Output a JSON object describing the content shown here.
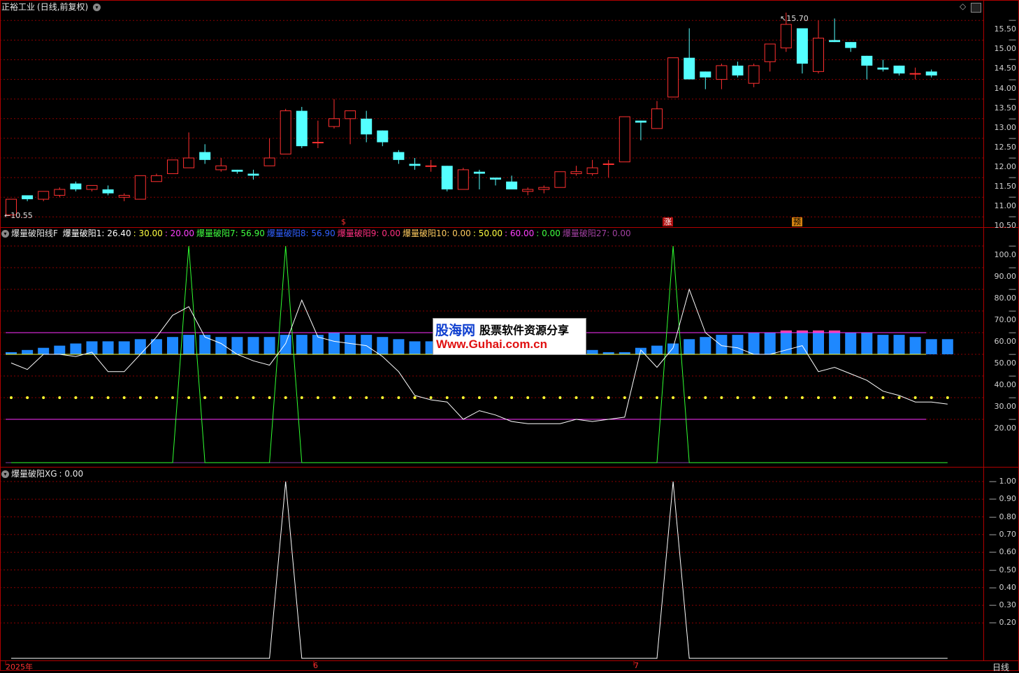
{
  "title": {
    "stock": "正裕工业",
    "period": "(日线,前复权)"
  },
  "price_axis": [
    "15.50",
    "15.00",
    "14.50",
    "14.00",
    "13.50",
    "13.00",
    "12.50",
    "12.00",
    "11.50",
    "11.00",
    "10.50"
  ],
  "price_annotations": {
    "high": "15.70",
    "low": "10.55"
  },
  "event_markers": [
    {
      "label": "$",
      "color": "#ff3030"
    },
    {
      "label": "涨",
      "color": "#ffffff",
      "bg": "#b01010"
    },
    {
      "label": "预",
      "color": "#000000",
      "bg": "#d08010"
    }
  ],
  "panel2": {
    "indicator_name": "爆量破阳线F",
    "legend": [
      {
        "text": "爆量破阳1: 26.40",
        "color": "#ffffff"
      },
      {
        "text": ": 30.00",
        "color": "#ffff40"
      },
      {
        "text": ": 20.00",
        "color": "#ff40ff"
      },
      {
        "text": "爆量破阳7: 56.90",
        "color": "#40ff40"
      },
      {
        "text": "爆量破阳8: 56.90",
        "color": "#3060ff"
      },
      {
        "text": "爆量破阳9: 0.00",
        "color": "#ff3080"
      },
      {
        "text": "爆量破阳10: 0.00",
        "color": "#ffcc60"
      },
      {
        "text": ": 50.00",
        "color": "#ffff40"
      },
      {
        "text": ": 60.00",
        "color": "#ff40ff"
      },
      {
        "text": ": 0.00",
        "color": "#40ff40"
      },
      {
        "text": "爆量破阳27: 0.00",
        "color": "#a040a0"
      }
    ],
    "axis": [
      "100.0",
      "90.00",
      "80.00",
      "70.00",
      "60.00",
      "50.00",
      "40.00",
      "30.00",
      "20.00"
    ]
  },
  "panel3": {
    "indicator_name": "爆量破阳XG",
    "value": ": 0.00",
    "axis": [
      "1.00",
      "0.90",
      "0.80",
      "0.70",
      "0.60",
      "0.50",
      "0.40",
      "0.30",
      "0.20"
    ]
  },
  "bottom_axis": {
    "year": "2025年",
    "m6": "6",
    "m7": "7",
    "period_button": "日线"
  },
  "watermark": {
    "logo": "股海网",
    "slogan": "股票软件资源分享",
    "url": "Www.Guhai.com.cn"
  },
  "colors": {
    "up": "#ff3030",
    "down": "#54ffff",
    "grid": "#8b0000",
    "bar_blue": "#1e88ff",
    "bar_pink": "#ff40a0"
  },
  "chart_data": [
    {
      "type": "candlestick",
      "title": "正裕工业 (日线,前复权)",
      "ylim": [
        10.4,
        15.7
      ],
      "ohlc": [
        [
          10.55,
          10.95,
          10.55,
          10.95
        ],
        [
          11.05,
          11.05,
          10.9,
          10.95
        ],
        [
          10.95,
          11.15,
          10.9,
          11.15
        ],
        [
          11.05,
          11.25,
          11.0,
          11.2
        ],
        [
          11.35,
          11.4,
          11.15,
          11.2
        ],
        [
          11.2,
          11.3,
          11.15,
          11.3
        ],
        [
          11.2,
          11.3,
          11.05,
          11.1
        ],
        [
          11.0,
          11.1,
          10.9,
          11.05
        ],
        [
          10.95,
          11.55,
          10.95,
          11.55
        ],
        [
          11.4,
          11.6,
          11.4,
          11.55
        ],
        [
          11.6,
          11.95,
          11.6,
          11.95
        ],
        [
          11.75,
          12.65,
          11.75,
          12.0
        ],
        [
          12.15,
          12.35,
          11.85,
          11.95
        ],
        [
          11.7,
          12.0,
          11.65,
          11.8
        ],
        [
          11.7,
          11.7,
          11.6,
          11.65
        ],
        [
          11.6,
          11.7,
          11.45,
          11.55
        ],
        [
          11.8,
          12.5,
          11.8,
          12.0
        ],
        [
          12.1,
          13.25,
          12.1,
          13.2
        ],
        [
          13.2,
          13.3,
          12.25,
          12.3
        ],
        [
          12.4,
          12.95,
          12.25,
          12.4
        ],
        [
          12.8,
          13.5,
          12.75,
          13.0
        ],
        [
          13.0,
          13.1,
          12.35,
          13.2
        ],
        [
          13.0,
          13.2,
          12.4,
          12.6
        ],
        [
          12.7,
          12.7,
          12.3,
          12.4
        ],
        [
          12.15,
          12.2,
          11.85,
          11.95
        ],
        [
          11.85,
          12.0,
          11.7,
          11.8
        ],
        [
          11.8,
          11.95,
          11.65,
          11.8
        ],
        [
          11.8,
          11.8,
          11.15,
          11.2
        ],
        [
          11.2,
          11.75,
          11.2,
          11.7
        ],
        [
          11.65,
          11.7,
          11.2,
          11.6
        ],
        [
          11.5,
          11.5,
          11.3,
          11.45
        ],
        [
          11.4,
          11.55,
          11.2,
          11.2
        ],
        [
          11.15,
          11.25,
          11.05,
          11.2
        ],
        [
          11.2,
          11.3,
          11.1,
          11.25
        ],
        [
          11.25,
          11.65,
          11.25,
          11.65
        ],
        [
          11.6,
          11.8,
          11.55,
          11.65
        ],
        [
          11.6,
          11.95,
          11.55,
          11.75
        ],
        [
          11.85,
          11.95,
          11.5,
          11.85
        ],
        [
          11.9,
          13.05,
          11.9,
          13.05
        ],
        [
          12.95,
          12.95,
          12.45,
          12.9
        ],
        [
          12.75,
          13.45,
          12.75,
          13.25
        ],
        [
          13.55,
          14.55,
          13.55,
          14.55
        ],
        [
          14.55,
          15.3,
          14.0,
          14.0
        ],
        [
          14.2,
          14.2,
          13.75,
          14.05
        ],
        [
          14.0,
          14.4,
          13.75,
          14.35
        ],
        [
          14.35,
          14.45,
          14.05,
          14.1
        ],
        [
          13.9,
          14.4,
          13.8,
          14.35
        ],
        [
          14.45,
          14.9,
          14.2,
          14.9
        ],
        [
          14.8,
          15.7,
          14.7,
          15.4
        ],
        [
          15.3,
          15.3,
          14.15,
          14.4
        ],
        [
          14.2,
          15.5,
          14.15,
          15.05
        ],
        [
          15.0,
          15.55,
          14.95,
          14.95
        ],
        [
          14.95,
          14.95,
          14.7,
          14.8
        ],
        [
          14.6,
          14.6,
          14.0,
          14.35
        ],
        [
          14.3,
          14.5,
          14.2,
          14.25
        ],
        [
          14.35,
          14.35,
          14.1,
          14.15
        ],
        [
          14.15,
          14.3,
          14.0,
          14.15
        ],
        [
          14.2,
          14.25,
          14.05,
          14.1
        ]
      ]
    },
    {
      "type": "line",
      "title": "爆量破阳线F",
      "ylim": [
        0,
        100
      ],
      "series": [
        {
          "name": "爆量破阳1",
          "values": [
            46,
            43,
            50,
            50,
            49,
            51,
            42,
            42,
            50,
            58,
            68,
            72,
            58,
            55,
            50,
            47,
            45,
            55,
            75,
            58,
            56,
            55,
            54,
            49,
            42,
            31,
            29,
            28,
            20,
            24,
            22,
            19,
            18,
            18,
            18,
            20,
            19,
            20,
            21,
            52,
            44,
            53,
            80,
            60,
            54,
            53,
            50,
            50,
            52,
            54,
            42,
            44,
            41,
            38,
            33,
            31,
            28,
            28,
            27
          ]
        },
        {
          "name": "爆量破阳7",
          "values": [
            0,
            0,
            0,
            0,
            0,
            0,
            0,
            0,
            0,
            0,
            0,
            100,
            0,
            0,
            0,
            0,
            0,
            100,
            0,
            0,
            0,
            0,
            0,
            0,
            0,
            0,
            0,
            0,
            0,
            0,
            0,
            0,
            0,
            0,
            0,
            0,
            0,
            0,
            0,
            0,
            0,
            100,
            0,
            0,
            0,
            0,
            0,
            0,
            0,
            0,
            0,
            0,
            0,
            0,
            0,
            0,
            0,
            0,
            0
          ]
        },
        {
          "name": "爆量破阳8",
          "values": [
            51,
            52,
            53,
            54,
            55,
            56,
            56,
            56,
            57,
            57,
            58,
            59,
            59,
            58,
            58,
            58,
            58,
            59,
            59,
            59,
            60,
            59,
            59,
            58,
            57,
            56,
            56,
            56,
            55,
            55,
            55,
            55,
            54,
            54,
            54,
            53,
            52,
            51,
            51,
            53,
            54,
            55,
            57,
            58,
            59,
            59,
            60,
            60,
            61,
            61,
            61,
            61,
            60,
            60,
            59,
            59,
            58,
            57,
            57
          ]
        },
        {
          "name": "爆量破阳9",
          "values": [
            0,
            0,
            0,
            0,
            0,
            0,
            0,
            0,
            0,
            0,
            0,
            0,
            0,
            0,
            0,
            0,
            0,
            0,
            0,
            0,
            0,
            0,
            0,
            0,
            0,
            0,
            0,
            0,
            0,
            0,
            0,
            0,
            0,
            0,
            0,
            0,
            0,
            0,
            0,
            0,
            0,
            0,
            0,
            0,
            0,
            0,
            0,
            0,
            61,
            61,
            61,
            61,
            0,
            0,
            0,
            0,
            0,
            0,
            0
          ]
        }
      ],
      "reference_lines": [
        30,
        20,
        50,
        60
      ]
    },
    {
      "type": "line",
      "title": "爆量破阳XG",
      "ylim": [
        0,
        1
      ],
      "series": [
        {
          "name": "爆量破阳XG",
          "values": [
            0,
            0,
            0,
            0,
            0,
            0,
            0,
            0,
            0,
            0,
            0,
            0,
            0,
            0,
            0,
            0,
            0,
            1,
            0,
            0,
            0,
            0,
            0,
            0,
            0,
            0,
            0,
            0,
            0,
            0,
            0,
            0,
            0,
            0,
            0,
            0,
            0,
            0,
            0,
            0,
            0,
            1,
            0,
            0,
            0,
            0,
            0,
            0,
            0,
            0,
            0,
            0,
            0,
            0,
            0,
            0,
            0,
            0,
            0
          ]
        }
      ]
    }
  ]
}
